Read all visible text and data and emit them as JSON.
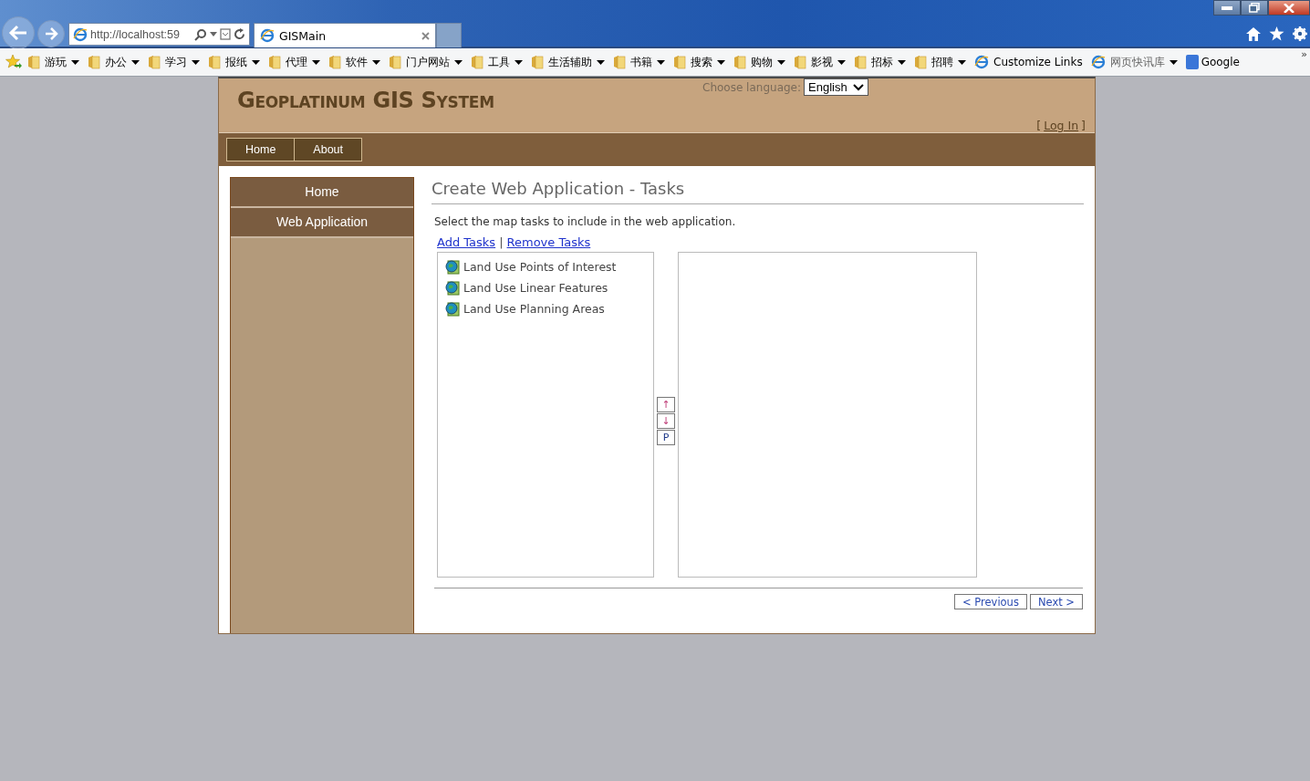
{
  "browser": {
    "address": "http://localhost:59",
    "tabs": [
      {
        "title": "GISMain",
        "selected": true
      }
    ]
  },
  "favorites": {
    "items": [
      {
        "label": "游玩",
        "kind": "folder"
      },
      {
        "label": "办公",
        "kind": "folder"
      },
      {
        "label": "学习",
        "kind": "folder"
      },
      {
        "label": "报纸",
        "kind": "folder"
      },
      {
        "label": "代理",
        "kind": "folder"
      },
      {
        "label": "软件",
        "kind": "folder"
      },
      {
        "label": "门户网站",
        "kind": "folder"
      },
      {
        "label": "工具",
        "kind": "folder"
      },
      {
        "label": "生活辅助",
        "kind": "folder"
      },
      {
        "label": "书籍",
        "kind": "folder"
      },
      {
        "label": "搜索",
        "kind": "folder"
      },
      {
        "label": "购物",
        "kind": "folder"
      },
      {
        "label": "影视",
        "kind": "folder"
      },
      {
        "label": "招标",
        "kind": "folder"
      },
      {
        "label": "招聘",
        "kind": "folder"
      },
      {
        "label": "Customize Links",
        "kind": "link"
      },
      {
        "label": "网页快讯库",
        "kind": "feed"
      },
      {
        "label": "Google",
        "kind": "google"
      }
    ],
    "more": "»"
  },
  "header": {
    "title": "Geoplatinum GIS System",
    "language_label": "Choose language:",
    "language": "English",
    "login": {
      "open": "[",
      "link": "Log In",
      "close": "]"
    }
  },
  "nav": [
    {
      "label": "Home"
    },
    {
      "label": "About"
    }
  ],
  "sidebar": {
    "items": [
      {
        "label": "Home"
      },
      {
        "label": "Web Application"
      }
    ]
  },
  "content": {
    "heading": "Create Web Application - Tasks",
    "instruction": "Select the map tasks to include in the web application.",
    "actions": [
      {
        "label": "Add Tasks"
      },
      {
        "label": "Remove Tasks"
      }
    ],
    "separator": "|",
    "available_tasks": [
      {
        "label": "Land Use Points of Interest"
      },
      {
        "label": "Land Use Linear Features"
      },
      {
        "label": "Land Use Planning Areas"
      }
    ],
    "order_buttons": [
      {
        "label": "↑",
        "kind": "arrow"
      },
      {
        "label": "↓",
        "kind": "arrow"
      },
      {
        "label": "P",
        "kind": "letter"
      }
    ],
    "wizard_buttons": [
      {
        "label": "< Previous"
      },
      {
        "label": "Next >"
      }
    ]
  }
}
